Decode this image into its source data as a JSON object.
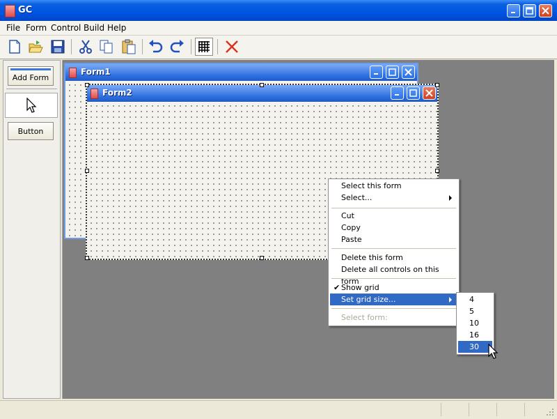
{
  "window": {
    "title": "GC"
  },
  "menubar": {
    "items": [
      "File",
      "Form",
      "Control",
      "Build",
      "Help"
    ]
  },
  "toolbar": {
    "buttons": [
      "new-icon",
      "open-icon",
      "save-icon",
      "cut-icon",
      "copy-icon",
      "paste-icon",
      "undo-icon",
      "redo-icon",
      "grid-icon",
      "delete-icon"
    ]
  },
  "palette": {
    "add_form_label": "Add Form",
    "button_label": "Button"
  },
  "forms": {
    "form1": {
      "title": "Form1"
    },
    "form2": {
      "title": "Form2"
    }
  },
  "context_menu": {
    "items": [
      "Select this form",
      "Select...",
      "Cut",
      "Copy",
      "Paste",
      "Delete this form",
      "Delete all controls on this form",
      "Show grid",
      "Set grid size...",
      "Select form:"
    ],
    "show_grid_checked": true,
    "highlight_color": "#316ac5"
  },
  "grid_size_menu": {
    "options": [
      "4",
      "5",
      "10",
      "16",
      "30"
    ],
    "selected": "30"
  },
  "colors": {
    "titlebar": "#0055e5",
    "design_area": "#808080",
    "selection": "#316ac5"
  }
}
